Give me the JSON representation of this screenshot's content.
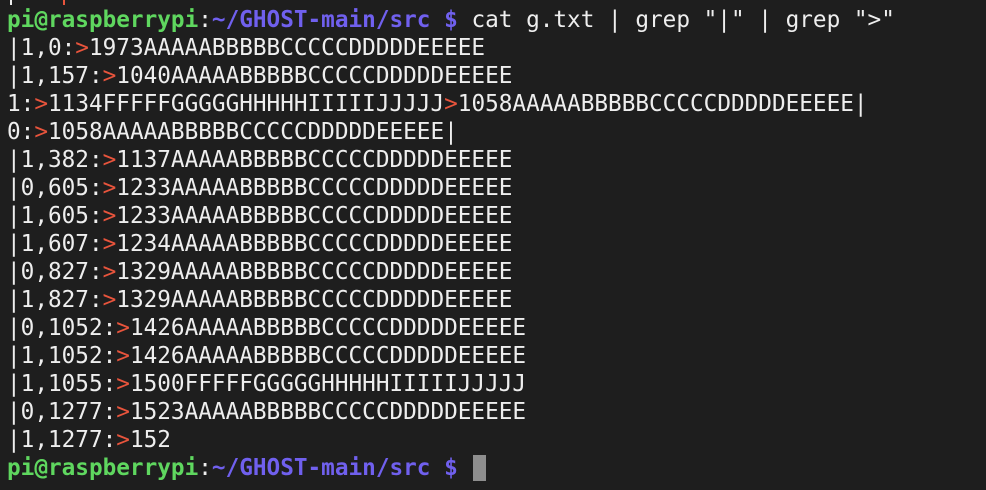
{
  "terminal": {
    "user_host": "pi@raspberrypi",
    "separator": ":",
    "cwd": "~/GHOST-main/src",
    "prompt_symbol": " $ ",
    "command": "cat g.txt | grep \"|\" | grep \">\"",
    "arrow": ">",
    "lines": [
      {
        "prefix": "|1,0:",
        "segments": [
          "1973AAAAABBBBBCCCCCDDDDDEEEEE"
        ]
      },
      {
        "prefix": "|1,157:",
        "segments": [
          "1040AAAAABBBBBCCCCCDDDDDEEEEE"
        ]
      },
      {
        "prefix": "1:",
        "segments": [
          "1134FFFFFGGGGGHHHHHIIIIIJJJJJ",
          "1058AAAAABBBBBCCCCCDDDDDEEEEE|"
        ]
      },
      {
        "prefix": "0:",
        "segments": [
          "1058AAAAABBBBBCCCCCDDDDDEEEEE|"
        ]
      },
      {
        "prefix": "|1,382:",
        "segments": [
          "1137AAAAABBBBBCCCCCDDDDDEEEEE"
        ]
      },
      {
        "prefix": "|0,605:",
        "segments": [
          "1233AAAAABBBBBCCCCCDDDDDEEEEE"
        ]
      },
      {
        "prefix": "|1,605:",
        "segments": [
          "1233AAAAABBBBBCCCCCDDDDDEEEEE"
        ]
      },
      {
        "prefix": "|1,607:",
        "segments": [
          "1234AAAAABBBBBCCCCCDDDDDEEEEE"
        ]
      },
      {
        "prefix": "|0,827:",
        "segments": [
          "1329AAAAABBBBBCCCCCDDDDDEEEEE"
        ]
      },
      {
        "prefix": "|1,827:",
        "segments": [
          "1329AAAAABBBBBCCCCCDDDDDEEEEE"
        ]
      },
      {
        "prefix": "|0,1052:",
        "segments": [
          "1426AAAAABBBBBCCCCCDDDDDEEEEE"
        ]
      },
      {
        "prefix": "|1,1052:",
        "segments": [
          "1426AAAAABBBBBCCCCCDDDDDEEEEE"
        ]
      },
      {
        "prefix": "|1,1055:",
        "segments": [
          "1500FFFFFGGGGGHHHHHIIIIIJJJJJ"
        ]
      },
      {
        "prefix": "|0,1277:",
        "segments": [
          "1523AAAAABBBBBCCCCCDDDDDEEEEE"
        ]
      },
      {
        "prefix": "|1,1277:",
        "segments": [
          "152"
        ]
      }
    ]
  },
  "colors": {
    "background": "#1e1e1e",
    "text": "#eeeeee",
    "user_host": "#5fd75f",
    "path": "#7060ee",
    "arrow": "#e8543c",
    "cursor": "#8e8e8e"
  }
}
